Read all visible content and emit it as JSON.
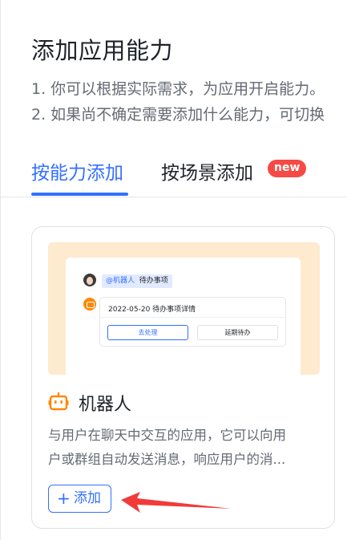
{
  "panel": {
    "title": "添加应用能力",
    "desc_1": "1. 你可以根据实际需求，为应用开启能力。",
    "desc_2": "2. 如果尚不确定需要添加什么能力，可切换"
  },
  "tabs": [
    {
      "label": "按能力添加",
      "active": true
    },
    {
      "label": "按场景添加",
      "active": false
    }
  ],
  "new_badge": "new",
  "card": {
    "preview": {
      "mention_at": "@机器人",
      "mention_text": "待办事项",
      "msg_title": "2022-05-20 待办事项详情",
      "btn_primary": "去处理",
      "btn_secondary": "延期待办"
    },
    "icon": "robot-icon",
    "name": "机器人",
    "desc_line1": "与用户在聊天中交互的应用，它可以向用",
    "desc_line2": "户或群组自动发送消息，响应用户的消...",
    "add_plus": "+",
    "add_label": "添加"
  },
  "colors": {
    "accent": "#3370ff",
    "badge": "#f54a45",
    "preview_bg": "#feeacf",
    "robot_icon": "#ff8800",
    "arrow": "#f23a3a"
  }
}
